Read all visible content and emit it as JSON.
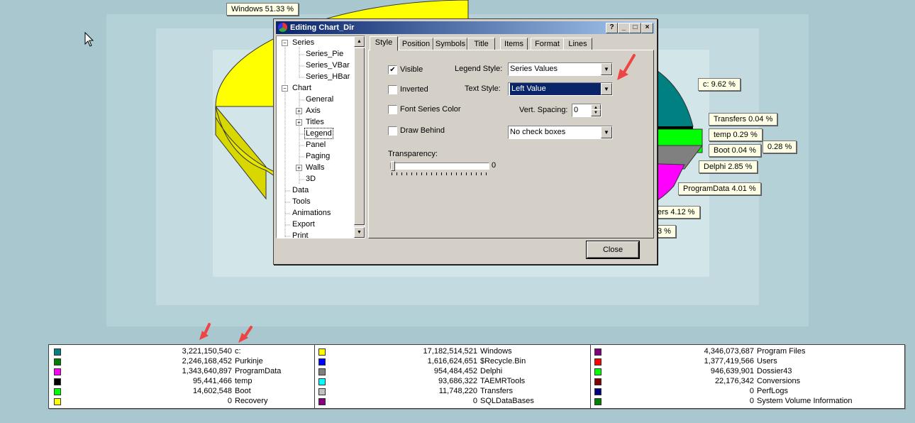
{
  "colors": {
    "windows": "#ffff00",
    "c": "#008080",
    "transfers": "#c0c0c0",
    "temp": "#000000",
    "boot": "#00ff00",
    "delphi": "#808080",
    "programdata": "#ff00ff"
  },
  "pie_labels": [
    {
      "text": "Windows  51.33 %"
    },
    {
      "text": "c:  9.62 %"
    },
    {
      "text": "Transfers  0.04 %"
    },
    {
      "text": "temp  0.29 %"
    },
    {
      "text": "0.28 %"
    },
    {
      "text": "Boot  0.04 %"
    },
    {
      "text": "Delphi  2.85 %"
    },
    {
      "text": "ProgramData  4.01 %"
    },
    {
      "text": "ers  4.12 %"
    },
    {
      "text": "3 %"
    }
  ],
  "dialog": {
    "title": "Editing Chart_Dir",
    "title_buttons": [
      "?",
      "_",
      "□",
      "×"
    ],
    "tree": [
      {
        "label": "Series",
        "expander": "−"
      },
      {
        "label": "Series_Pie"
      },
      {
        "label": "Series_VBar"
      },
      {
        "label": "Series_HBar"
      },
      {
        "label": "Chart",
        "expander": "−"
      },
      {
        "label": "General"
      },
      {
        "label": "Axis",
        "expander": "+"
      },
      {
        "label": "Titles",
        "expander": "+"
      },
      {
        "label": "Legend",
        "selected": true
      },
      {
        "label": "Panel"
      },
      {
        "label": "Paging"
      },
      {
        "label": "Walls",
        "expander": "+"
      },
      {
        "label": "3D"
      },
      {
        "label": "Data"
      },
      {
        "label": "Tools"
      },
      {
        "label": "Animations"
      },
      {
        "label": "Export"
      },
      {
        "label": "Print"
      }
    ],
    "tabs": [
      "Style",
      "Position",
      "Symbols",
      "Title",
      "Items",
      "Format",
      "Lines"
    ],
    "active_tab": "Style",
    "style": {
      "visible_label": "Visible",
      "visible_checked": true,
      "inverted_label": "Inverted",
      "font_series_color_label": "Font Series Color",
      "draw_behind_label": "Draw Behind",
      "legend_style_label": "Legend Style:",
      "legend_style_value": "Series Values",
      "text_style_label": "Text Style:",
      "text_style_value": "Left Value",
      "vert_spacing_label": "Vert. Spacing:",
      "vert_spacing_value": "0",
      "checkboxes_value": "No check boxes",
      "transparency_label": "Transparency:",
      "transparency_value": "0"
    },
    "close_label": "Close"
  },
  "legend": {
    "columns": [
      [
        {
          "value": "3,221,150,540",
          "name": "c:",
          "color": "#008080"
        },
        {
          "value": "2,246,168,452",
          "name": "Purkinje",
          "color": "#008000"
        },
        {
          "value": "1,343,640,897",
          "name": "ProgramData",
          "color": "#ff00ff"
        },
        {
          "value": "95,441,466",
          "name": "temp",
          "color": "#000000"
        },
        {
          "value": "14,602,548",
          "name": "Boot",
          "color": "#00ff00"
        },
        {
          "value": "0",
          "name": "Recovery",
          "color": "#ffff00"
        }
      ],
      [
        {
          "value": "17,182,514,521",
          "name": "Windows",
          "color": "#ffff00"
        },
        {
          "value": "1,616,624,651",
          "name": "$Recycle.Bin",
          "color": "#0000ff"
        },
        {
          "value": "954,484,452",
          "name": "Delphi",
          "color": "#808080"
        },
        {
          "value": "93,686,322",
          "name": "TAEMRTools",
          "color": "#00ffff"
        },
        {
          "value": "11,748,220",
          "name": "Transfers",
          "color": "#c0c0c0"
        },
        {
          "value": "0",
          "name": "SQLDataBases",
          "color": "#800080"
        }
      ],
      [
        {
          "value": "4,346,073,687",
          "name": "Program Files",
          "color": "#800080"
        },
        {
          "value": "1,377,419,566",
          "name": "Users",
          "color": "#ff0000"
        },
        {
          "value": "946,639,901",
          "name": "Dossier43",
          "color": "#00ff00"
        },
        {
          "value": "22,176,342",
          "name": "Conversions",
          "color": "#800000"
        },
        {
          "value": "0",
          "name": "PerfLogs",
          "color": "#000080"
        },
        {
          "value": "0",
          "name": "System Volume Information",
          "color": "#008000"
        }
      ]
    ]
  }
}
